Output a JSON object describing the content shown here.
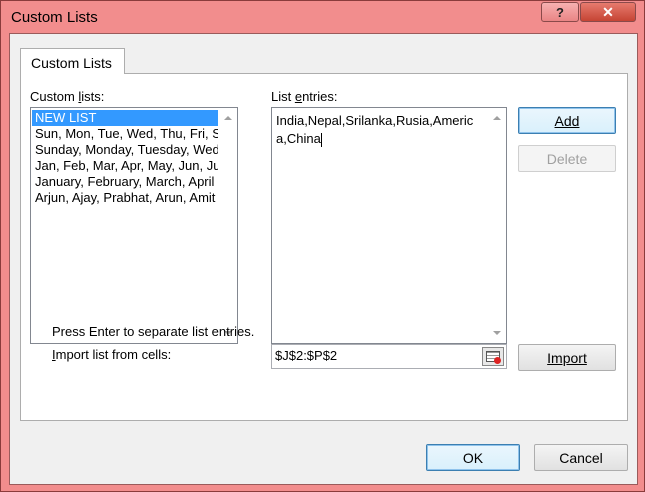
{
  "window": {
    "title": "Custom Lists",
    "help_label": "?",
    "close_label": "✕"
  },
  "tab": {
    "label": "Custom Lists"
  },
  "custom_lists": {
    "label_pre": "Custom ",
    "label_u": "l",
    "label_post": "ists:",
    "items": [
      {
        "label": "NEW LIST",
        "selected": true
      },
      {
        "label": "Sun, Mon, Tue, Wed, Thu, Fri, Sat",
        "selected": false
      },
      {
        "label": "Sunday, Monday, Tuesday, Wednesday",
        "selected": false
      },
      {
        "label": "Jan, Feb, Mar, Apr, May, Jun, Jul",
        "selected": false
      },
      {
        "label": "January, February, March, April",
        "selected": false
      },
      {
        "label": "Arjun, Ajay, Prabhat, Arun, Amit",
        "selected": false
      }
    ]
  },
  "list_entries": {
    "label_pre": "List ",
    "label_u": "e",
    "label_post": "ntries:",
    "value": "India,Nepal,Srilanka,Rusia,America,China"
  },
  "buttons": {
    "add": "Add",
    "delete": "Delete",
    "import": "Import",
    "ok": "OK",
    "cancel": "Cancel"
  },
  "hint": "Press Enter to separate list entries.",
  "import_from": {
    "label_u": "I",
    "label_post": "mport list from cells:",
    "value": "$J$2:$P$2"
  }
}
